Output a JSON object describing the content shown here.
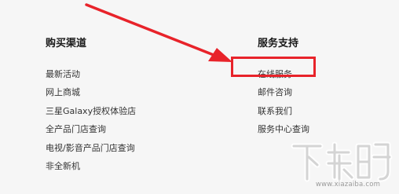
{
  "purchase_channels": {
    "title": "购买渠道",
    "items": [
      {
        "label": "最新活动"
      },
      {
        "label": "网上商城"
      },
      {
        "label": "三星Galaxy授权体验店"
      },
      {
        "label": "全产品门店查询"
      },
      {
        "label": "电视/影音产品门店查询"
      },
      {
        "label": "非全新机"
      }
    ]
  },
  "service_support": {
    "title": "服务支持",
    "items": [
      {
        "label": "在线服务"
      },
      {
        "label": "邮件咨询"
      },
      {
        "label": "联系我们"
      },
      {
        "label": "服务中心查询"
      }
    ]
  },
  "annotation": {
    "highlight_color": "#e8232a",
    "arrow_color": "#e8232a"
  },
  "watermark": {
    "logo": "下载吧",
    "site": "www.xiazaiba.com"
  }
}
